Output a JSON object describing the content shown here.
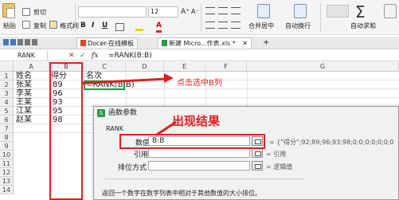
{
  "ribbon": {
    "paste_label": "粘贴",
    "cut_label": "剪切",
    "copy_label": "复制",
    "format_painter_label": "格式刷",
    "font_size": "12",
    "merge_center_label": "合并居中",
    "wrap_text_label": "自动换行",
    "autosum_label": "自动求和"
  },
  "tabs": [
    {
      "label": "Docer-在线模板"
    },
    {
      "label": "新建 Micro...作表.xls *"
    }
  ],
  "formula_bar": {
    "name_box": "RANK",
    "cancel_symbol": "✕",
    "confirm_symbol": "✓",
    "fx_symbol": "fx",
    "formula": "=RANK(B:B)"
  },
  "grid": {
    "columns": [
      "A",
      "B",
      "C",
      "D",
      "E",
      "F",
      "G"
    ],
    "rows": [
      "1",
      "2",
      "3",
      "4",
      "5",
      "6",
      "7",
      "8",
      "9",
      "10",
      "11",
      "12",
      "13",
      "14"
    ],
    "cells": {
      "A1": "姓名",
      "B1": "得分",
      "C1": "名次",
      "A2": "张某",
      "B2": "89",
      "C2": "=RANK(B:B)",
      "A3": "李某",
      "B3": "96",
      "A4": "王某",
      "B4": "93",
      "A5": "江某",
      "B5": "95",
      "A6": "赵某",
      "B6": "98"
    }
  },
  "annotations": {
    "select_column": "点击选中B列",
    "result_appears": "出现结果"
  },
  "dialog": {
    "title": "函数参数",
    "function_name": "RANK",
    "fields": [
      {
        "label": "数值",
        "value": "B:B",
        "evaluation": "= {\"得分\";92;89;96;93;98;0;0;0;0;0;0;0"
      },
      {
        "label": "引用",
        "value": "",
        "evaluation": "= 引用"
      },
      {
        "label": "排位方式",
        "value": "",
        "evaluation": "= 逻辑值"
      }
    ],
    "description": "返回一个数字在数字列表中相对于其他数值的大小排位。"
  }
}
